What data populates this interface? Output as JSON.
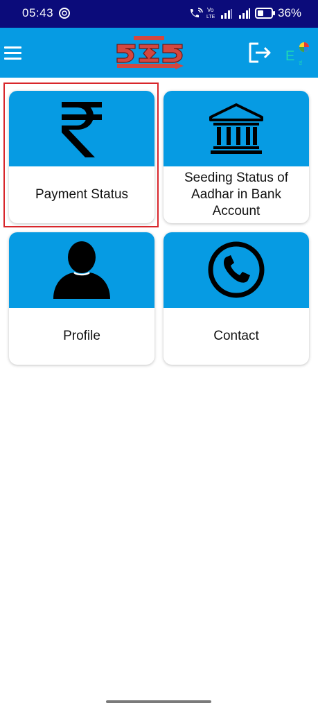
{
  "status_bar": {
    "time": "05:43",
    "battery_percent": "36%",
    "icons": [
      "data-saver-icon",
      "wifi-call-icon",
      "volte-icon",
      "signal-icon",
      "signal-icon",
      "battery-icon"
    ]
  },
  "app_bar": {
    "menu_icon": "hamburger-menu-icon",
    "logo": "app-logo",
    "logout_icon": "logout-icon",
    "language_icon": "language-switch-icon"
  },
  "tiles": [
    {
      "label": "Payment Status",
      "icon": "rupee-icon"
    },
    {
      "label": "Seeding Status of Aadhar in Bank Account",
      "icon": "bank-icon"
    },
    {
      "label": "Profile",
      "icon": "user-icon"
    },
    {
      "label": "Contact",
      "icon": "phone-icon"
    }
  ],
  "colors": {
    "status_bar_bg": "#0b0b7a",
    "accent": "#069be3",
    "highlight_border": "#d8262b",
    "text": "#111111"
  }
}
